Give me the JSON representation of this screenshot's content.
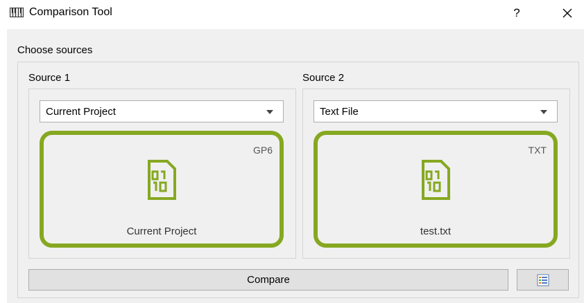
{
  "window": {
    "title": "Comparison Tool",
    "help_label": "?"
  },
  "group": {
    "label": "Choose sources"
  },
  "source1": {
    "label": "Source 1",
    "selected": "Current Project",
    "card_extension": "GP6",
    "card_name": "Current Project"
  },
  "source2": {
    "label": "Source 2",
    "selected": "Text File",
    "card_extension": "TXT",
    "card_name": "test.txt"
  },
  "actions": {
    "compare_label": "Compare"
  },
  "colors": {
    "accent": "#86a821",
    "panel_bg": "#f0f0f0",
    "button_bg": "#e1e1e1"
  },
  "icons": {
    "app": "gp6-app-icon",
    "file": "binary-file-icon",
    "view": "report-view-icon"
  }
}
